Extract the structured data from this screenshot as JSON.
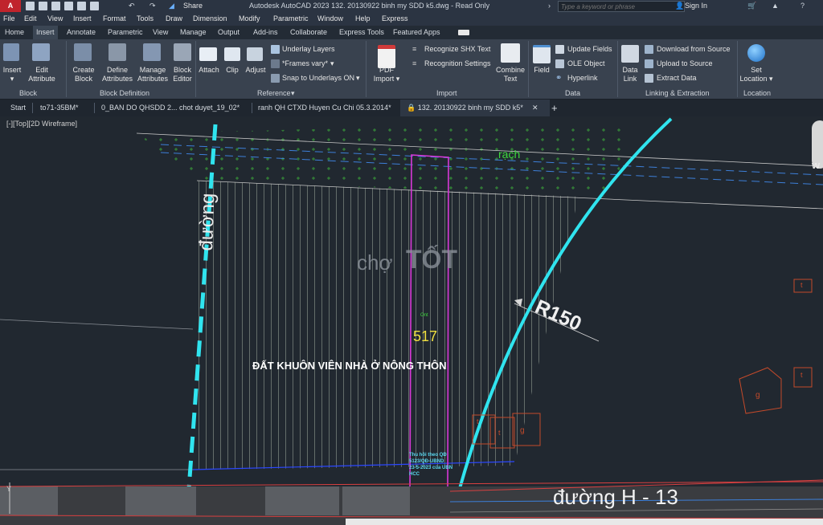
{
  "app": {
    "logo": "A CAD",
    "share": "Share",
    "title": "Autodesk AutoCAD 2023    132. 20130922 binh my SDD k5.dwg - Read Only",
    "search_placeholder": "Type a keyword or phrase",
    "signin": "Sign In"
  },
  "menu": [
    "File",
    "Edit",
    "View",
    "Insert",
    "Format",
    "Tools",
    "Draw",
    "Dimension",
    "Modify",
    "Parametric",
    "Window",
    "Help",
    "Express"
  ],
  "ribbon_tabs": [
    "Home",
    "Insert",
    "Annotate",
    "Parametric",
    "View",
    "Manage",
    "Output",
    "Add-ins",
    "Collaborate",
    "Express Tools",
    "Featured Apps"
  ],
  "active_ribbon_tab": "Insert",
  "ribbon": {
    "insert": "Insert",
    "edit_attribute_1": "Edit",
    "edit_attribute_2": "Attribute",
    "create_block_1": "Create",
    "create_block_2": "Block",
    "define_attributes_1": "Define",
    "define_attributes_2": "Attributes",
    "manage_attributes_1": "Manage",
    "manage_attributes_2": "Attributes",
    "block_editor_1": "Block",
    "block_editor_2": "Editor",
    "attach": "Attach",
    "clip": "Clip",
    "adjust": "Adjust",
    "underlay_layers": "Underlay Layers",
    "frames_vary": "*Frames vary*",
    "snap_underlays": "Snap to Underlays ON",
    "pdf_import_1": "PDF",
    "pdf_import_2": "Import",
    "recognize_shx": "Recognize SHX Text",
    "recognition_settings": "Recognition Settings",
    "combine_text_1": "Combine",
    "combine_text_2": "Text",
    "field": "Field",
    "update_fields": "Update Fields",
    "ole_object": "OLE Object",
    "hyperlink": "Hyperlink",
    "data_link_1": "Data",
    "data_link_2": "Link",
    "download_source": "Download from Source",
    "upload_source": "Upload to Source",
    "extract_data": "Extract  Data",
    "set_location_1": "Set",
    "set_location_2": "Location",
    "panels": {
      "block": "Block",
      "block_definition": "Block Definition",
      "reference": "Reference",
      "import": "Import",
      "data": "Data",
      "linking": "Linking & Extraction",
      "location": "Location"
    }
  },
  "file_tabs": {
    "start": "Start",
    "tab1": "to71-35BM*",
    "tab2": "0_BAN DO QHSDD 2... chot duyet_19_02*",
    "tab3": "ranh QH CTXD Huyen Cu Chi 05.3.2014*",
    "tab4": "132. 20130922 binh my SDD k5*",
    "new_tab": "+"
  },
  "viewport": {
    "label": "[-][Top][2D Wireframe]"
  },
  "drawing": {
    "road_left": "đường",
    "canal": "rạch",
    "radius": "R150",
    "parcel_number": "517",
    "land_use": "ĐẤT KHUÔN VIÊN NHÀ Ở NÔNG THÔN",
    "road_bottom": "đường H - 13",
    "note_1": "Thu hồi theo QĐ",
    "note_2": "5123/QĐ-UBND",
    "note_3": "23-5-2023 của UBN",
    "note_4": "HCC",
    "small_label": "Ont",
    "label_t1": "t",
    "label_t2": "t",
    "label_g1": "g",
    "label_g2": "g",
    "label_t3": "t",
    "label_t4": "t",
    "edge_letter": "w",
    "watermark_1": "chợ",
    "watermark_2": "TỐT"
  }
}
